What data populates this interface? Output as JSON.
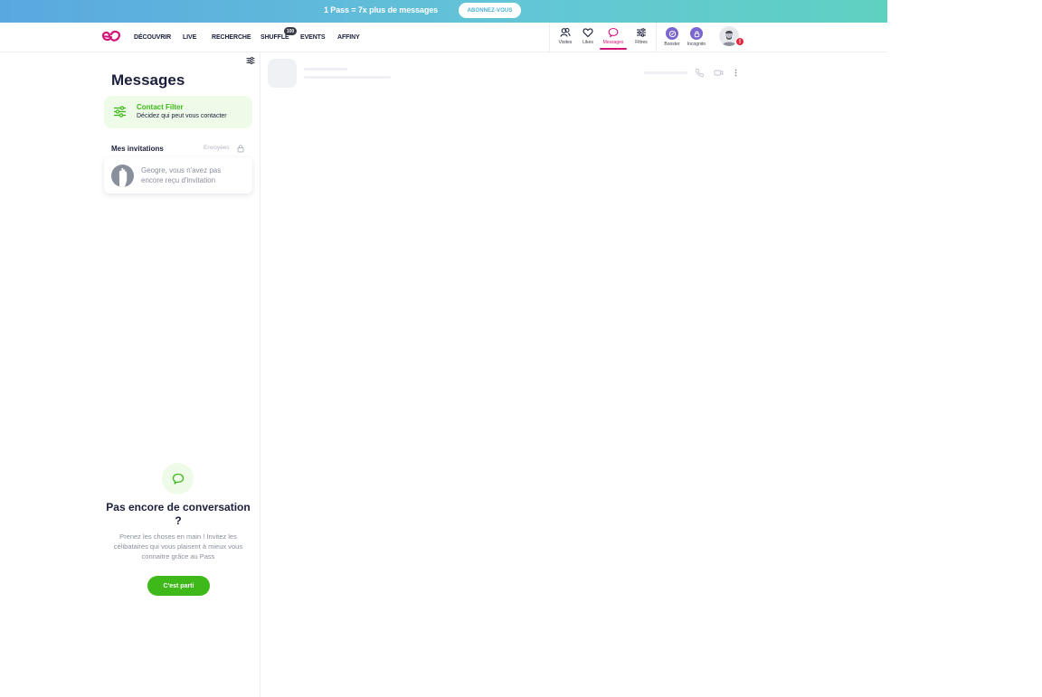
{
  "promo": {
    "text": "1 Pass = 7x plus de messages",
    "button": "ABONNEZ-VOUS"
  },
  "nav": {
    "links": [
      "DÉCOUVRIR",
      "LIVE",
      "RECHERCHE",
      "SHUFFLE",
      "EVENTS",
      "AFFINY"
    ],
    "shuffle_badge": "100",
    "icons": {
      "visites": "Visites",
      "likes": "Likes",
      "messages": "Messages",
      "filtres": "Filtres",
      "booster": "Booster",
      "incognito": "Incognito"
    },
    "avatar_alert": "!"
  },
  "sidebar": {
    "title": "Messages",
    "contact_filter": {
      "title": "Contact Filter",
      "subtitle": "Décidez qui peut vous contacter"
    },
    "invitations": {
      "title": "Mes invitations",
      "sent": "Envoyées",
      "empty": "Geogre, vous n'avez pas encore reçu d'invitation"
    },
    "empty_state": {
      "title": "Pas encore de conversation ?",
      "text": "Prenez les choses en main ! Invitez les célibataires qui vous plaisent à mieux vous connaitre grâce au Pass",
      "button": "C'est parti"
    }
  },
  "colors": {
    "accent_pink": "#d3127a",
    "green": "#3fb81a",
    "purple": "#7b66d0"
  }
}
